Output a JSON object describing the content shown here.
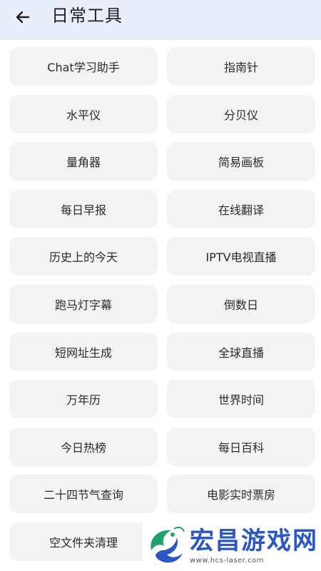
{
  "header": {
    "title": "日常工具",
    "back_icon": "arrow-left-icon"
  },
  "tools": [
    "Chat学习助手",
    "指南针",
    "水平仪",
    "分贝仪",
    "量角器",
    "简易画板",
    "每日早报",
    "在线翻译",
    "历史上的今天",
    "IPTV电视直播",
    "跑马灯字幕",
    "倒数日",
    "短网址生成",
    "全球直播",
    "万年历",
    "世界时间",
    "今日热榜",
    "每日百科",
    "二十四节气查询",
    "电影实时票房",
    "空文件夹清理"
  ],
  "watermark": {
    "text": "宏昌游戏网",
    "url": "www.hcs-laser.com"
  },
  "colors": {
    "header_bg": "#e8effa",
    "tile_bg": "#f3f3f3",
    "watermark_blue": "#2a57c4",
    "watermark_green": "#1fa36b"
  }
}
